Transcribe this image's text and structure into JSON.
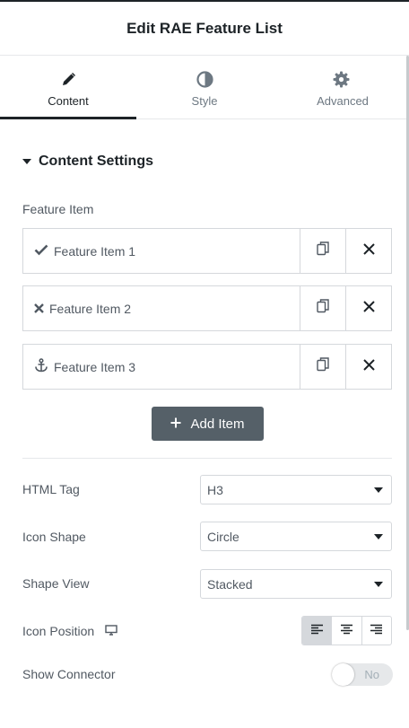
{
  "header": {
    "title": "Edit RAE Feature List"
  },
  "tabs": [
    {
      "label": "Content",
      "icon": "pencil-icon",
      "active": true
    },
    {
      "label": "Style",
      "icon": "half-circle-icon",
      "active": false
    },
    {
      "label": "Advanced",
      "icon": "gear-icon",
      "active": false
    }
  ],
  "section": {
    "title": "Content Settings"
  },
  "repeater": {
    "label": "Feature Item",
    "items": [
      {
        "title": "Feature Item 1",
        "icon": "check-icon"
      },
      {
        "title": "Feature Item 2",
        "icon": "times-icon"
      },
      {
        "title": "Feature Item 3",
        "icon": "anchor-icon"
      }
    ],
    "add_label": "Add Item"
  },
  "controls": {
    "html_tag": {
      "label": "HTML Tag",
      "value": "H3"
    },
    "icon_shape": {
      "label": "Icon Shape",
      "value": "Circle"
    },
    "shape_view": {
      "label": "Shape View",
      "value": "Stacked"
    },
    "icon_position": {
      "label": "Icon Position",
      "selected": "left"
    },
    "show_connector": {
      "label": "Show Connector",
      "value": "No"
    }
  }
}
